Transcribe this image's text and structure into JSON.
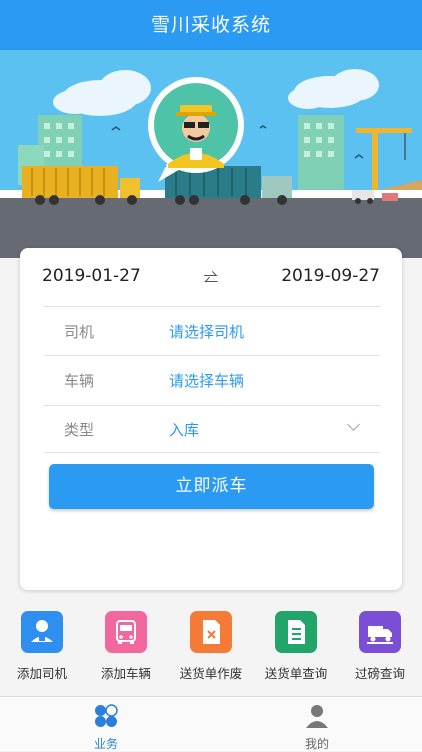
{
  "header": {
    "title": "雪川采收系统"
  },
  "filter": {
    "start_date": "2019-01-27",
    "end_date": "2019-09-27",
    "swap_icon": "swap-arrows-icon",
    "driver_label": "司机",
    "driver_value": "请选择司机",
    "vehicle_label": "车辆",
    "vehicle_value": "请选择车辆",
    "type_label": "类型",
    "type_value": "入库",
    "submit_label": "立即派车"
  },
  "shortcuts": [
    {
      "label": "添加司机",
      "icon": "add-driver-icon",
      "color": "#2f8ff0"
    },
    {
      "label": "添加车辆",
      "icon": "add-vehicle-icon",
      "color": "#f2679e"
    },
    {
      "label": "送货单作废",
      "icon": "void-delivery-note-icon",
      "color": "#f37b37"
    },
    {
      "label": "送货单查询",
      "icon": "delivery-note-query-icon",
      "color": "#22a56a"
    },
    {
      "label": "过磅查询",
      "icon": "weighing-query-icon",
      "color": "#7a4fd6"
    }
  ],
  "tabbar": {
    "tabs": [
      {
        "label": "业务",
        "icon": "business-icon",
        "active": true
      },
      {
        "label": "我的",
        "icon": "profile-icon",
        "active": false
      }
    ]
  },
  "colors": {
    "accent": "#2b9af3",
    "active_tab": "#2b7fd8",
    "inactive_tab": "#666666"
  }
}
